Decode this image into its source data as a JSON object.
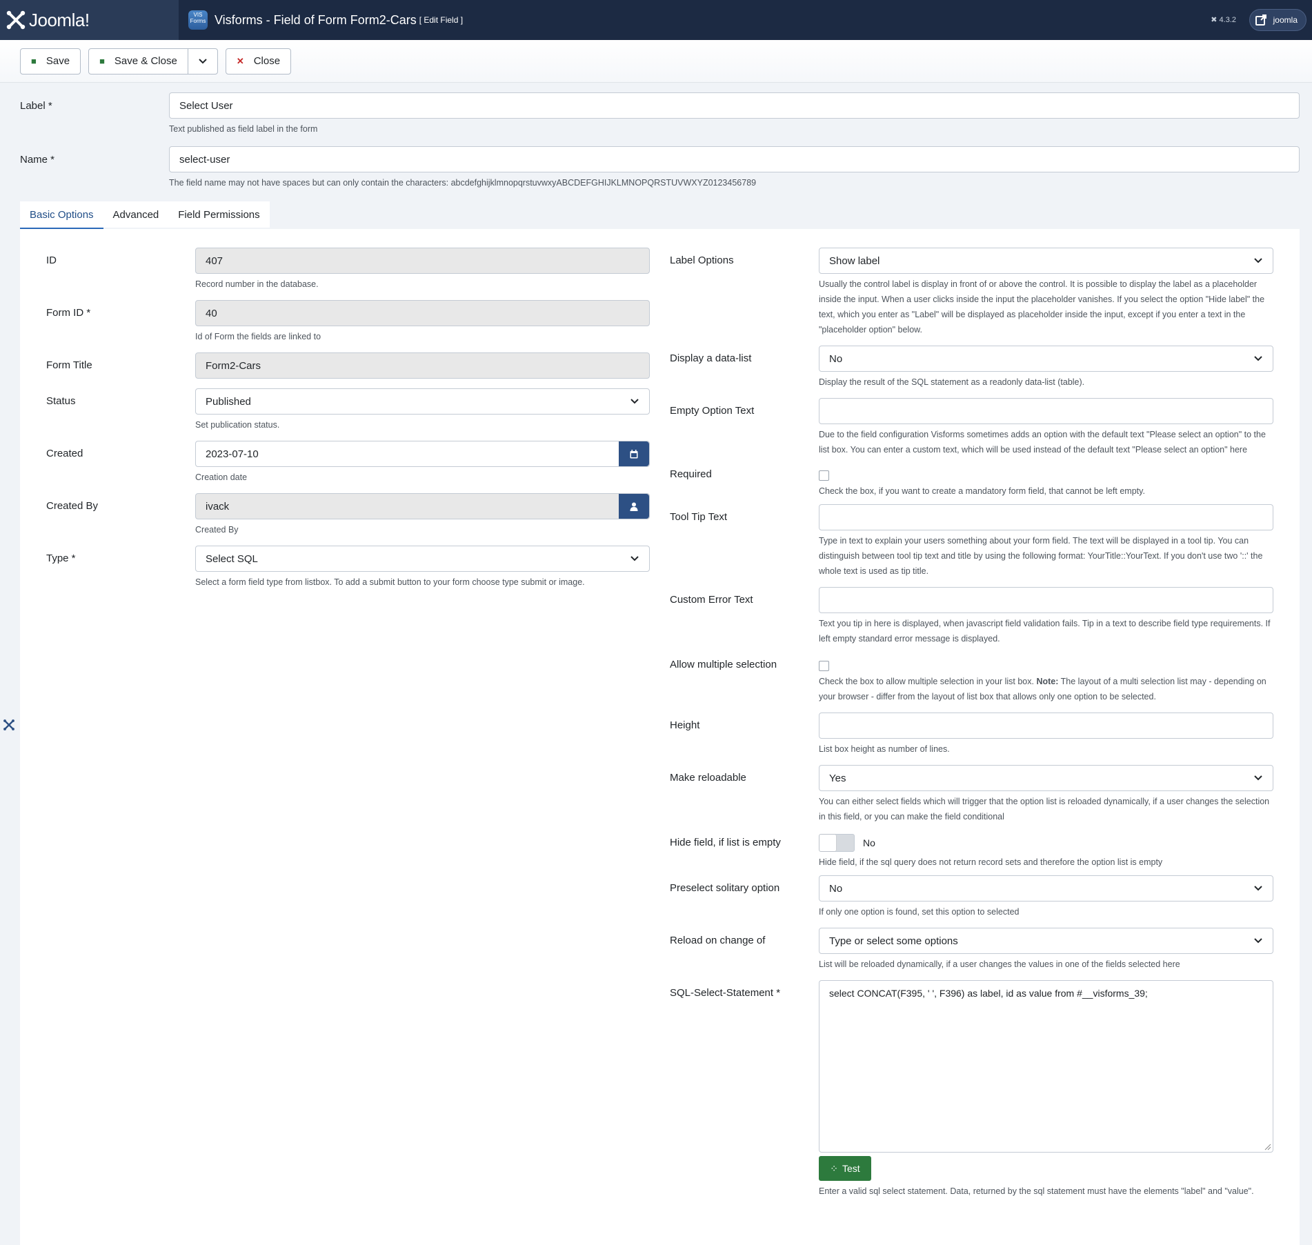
{
  "header": {
    "brand": "Joomla!",
    "component_icon_text": "VIS\nForms",
    "title": "Visforms - Field of Form Form2-Cars",
    "subtitle": "[ Edit Field ]",
    "version": "4.3.2",
    "user_label": "joomla"
  },
  "toolbar": {
    "save_label": "Save",
    "save_close_label": "Save & Close",
    "close_label": "Close"
  },
  "top_form": {
    "label_label": "Label *",
    "label_value": "Select User",
    "label_help": "Text published as field label in the form",
    "name_label": "Name *",
    "name_value": "select-user",
    "name_help": "The field name may not have spaces but can only contain the characters: abcdefghijklmnopqrstuvwxyABCDEFGHIJKLMNOPQRSTUVWXYZ0123456789"
  },
  "tabs": [
    "Basic Options",
    "Advanced",
    "Field Permissions"
  ],
  "left": {
    "id": {
      "label": "ID",
      "value": "407",
      "help": "Record number in the database."
    },
    "form_id": {
      "label": "Form ID *",
      "value": "40",
      "help": "Id of Form the fields are linked to"
    },
    "form_title": {
      "label": "Form Title",
      "value": "Form2-Cars"
    },
    "status": {
      "label": "Status",
      "value": "Published",
      "help": "Set publication status."
    },
    "created": {
      "label": "Created",
      "value": "2023-07-10",
      "help": "Creation date"
    },
    "created_by": {
      "label": "Created By",
      "value": "ivack",
      "help": "Created By"
    },
    "type": {
      "label": "Type *",
      "value": "Select SQL",
      "help": "Select a form field type from listbox. To add a submit button to your form choose type submit or image."
    }
  },
  "right": {
    "label_options": {
      "label": "Label Options",
      "value": "Show label",
      "help": "Usually the control label is display in front of or above the control. It is possible to display the label as a placeholder inside the input. When a user clicks inside the input the placeholder vanishes. If you select the option \"Hide label\" the text, which you enter as \"Label\" will be displayed as placeholder inside the input, except if you enter a text in the \"placeholder option\" below."
    },
    "data_list": {
      "label": "Display a data-list",
      "value": "No",
      "help": "Display the result of the SQL statement as a readonly data-list (table)."
    },
    "empty_option": {
      "label": "Empty Option Text",
      "value": "",
      "help": "Due to the field configuration Visforms sometimes adds an option with the default text \"Please select an option\" to the list box. You can enter a custom text, which will be used instead of the default text \"Please select an option\" here"
    },
    "required": {
      "label": "Required",
      "help": "Check the box, if you want to create a mandatory form field, that cannot be left empty."
    },
    "tooltip": {
      "label": "Tool Tip Text",
      "value": "",
      "help": "Type in text to explain your users something about your form field. The text will be displayed in a tool tip. You can distinguish between tool tip text and title by using the following format: YourTitle::YourText. If you don't use two '::' the whole text is used as tip title."
    },
    "custom_error": {
      "label": "Custom Error Text",
      "value": "",
      "help": "Text you tip in here is displayed, when javascript field validation fails. Tip in a text to describe field type requirements. If left empty standard error message is displayed."
    },
    "multiple": {
      "label": "Allow multiple selection",
      "help_prefix": "Check the box to allow multiple selection in your list box.",
      "help_note": "Note:",
      "help_suffix": "The layout of a multi selection list may - depending on your browser - differ from the layout of list box that allows only one option to be selected."
    },
    "height": {
      "label": "Height",
      "value": "",
      "help": "List box height as number of lines."
    },
    "reloadable": {
      "label": "Make reloadable",
      "value": "Yes",
      "help": "You can either select fields which will trigger that the option list is reloaded dynamically, if a user changes the selection in this field, or you can make the field conditional"
    },
    "hide_empty": {
      "label": "Hide field, if list is empty",
      "value": "No",
      "help": "Hide field, if the sql query does not return record sets and therefore the option list is empty"
    },
    "preselect": {
      "label": "Preselect solitary option",
      "value": "No",
      "help": "If only one option is found, set this option to selected"
    },
    "reload_on": {
      "label": "Reload on change of",
      "value": "Type or select some options",
      "help": "List will be reloaded dynamically, if a user changes the values in one of the fields selected here"
    },
    "sql": {
      "label": "SQL-Select-Statement *",
      "value": "select CONCAT(F395, ' ', F396) as label, id as value from #__visforms_39;",
      "test_label": "Test",
      "help": "Enter a valid sql select statement. Data, returned by the sql statement must have the elements \"label\" and \"value\"."
    }
  }
}
